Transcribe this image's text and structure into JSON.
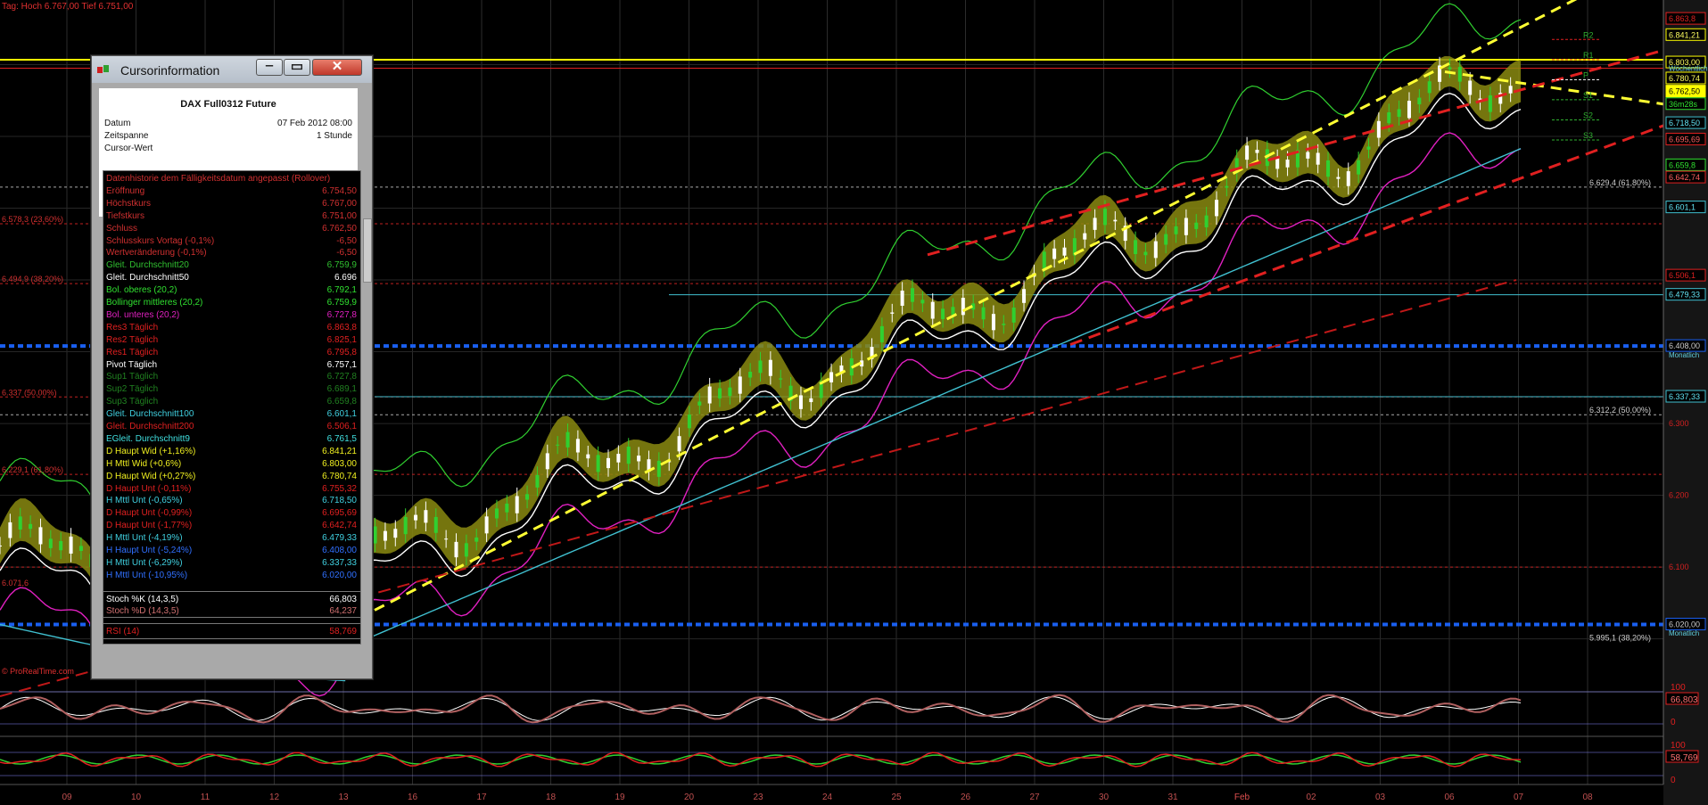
{
  "top_info": "Tag: Hoch 6.767,00  Tief 6.751,00",
  "watermark": "© ProRealTime.com",
  "colors": {
    "background": "#000000",
    "grid": "#2b2b2b",
    "price_axis_bg": "#1a1a1a",
    "red": "#e02020",
    "yellow": "#ffff00",
    "blue": "#1060ff",
    "cyan": "#40c0d0",
    "green": "#30d030",
    "magenta": "#e020c0",
    "olive": "#9a9a10"
  },
  "x_axis": [
    "09",
    "10",
    "11",
    "12",
    "13",
    "16",
    "17",
    "18",
    "19",
    "20",
    "23",
    "24",
    "25",
    "26",
    "27",
    "30",
    "31",
    "Feb",
    "02",
    "03",
    "06",
    "07",
    "08"
  ],
  "price_axis": [
    {
      "label": "6.863,8",
      "price": 6863.8,
      "style": "red"
    },
    {
      "label": "6.841,21",
      "price": 6841.21,
      "style": "yellowbox"
    },
    {
      "label": "6.803,00",
      "price": 6803.0,
      "style": "yellowbox"
    },
    {
      "label": "Wöchentlich",
      "price": 6795,
      "style": "cyantext"
    },
    {
      "label": "6.780,74",
      "price": 6780.74,
      "style": "yellowbox"
    },
    {
      "label": "6.762,50",
      "price": 6762.5,
      "style": "current"
    },
    {
      "label": "36m28s",
      "price": 6745,
      "style": "greenbox"
    },
    {
      "label": "6.718,50",
      "price": 6718.5,
      "style": "cyanbox"
    },
    {
      "label": "6.695,69",
      "price": 6695.69,
      "style": "redbox"
    },
    {
      "label": "6.659,8",
      "price": 6659.8,
      "style": "greenbox"
    },
    {
      "label": "6.642,74",
      "price": 6642.74,
      "style": "redbox"
    },
    {
      "label": "6.601,1",
      "price": 6601.1,
      "style": "cyanbox"
    },
    {
      "label": "6.506,1",
      "price": 6506.1,
      "style": "red"
    },
    {
      "label": "6.479,33",
      "price": 6479.33,
      "style": "cyanbox"
    },
    {
      "label": "6.408,00",
      "price": 6408.0,
      "style": "bluebox"
    },
    {
      "label": "Monatlich",
      "price": 6396,
      "style": "cyantext"
    },
    {
      "label": "6.337,33",
      "price": 6337.33,
      "style": "cyanbox"
    },
    {
      "label": "6.300",
      "price": 6300,
      "style": "tick"
    },
    {
      "label": "6.200",
      "price": 6200,
      "style": "tick"
    },
    {
      "label": "6.100",
      "price": 6100,
      "style": "tick"
    },
    {
      "label": "6.020,00",
      "price": 6020.0,
      "style": "bluebox"
    },
    {
      "label": "Monatlich",
      "price": 6008,
      "style": "cyantext"
    }
  ],
  "fib_labels": [
    {
      "label": "6.629,4 (61,80%)",
      "price": 6629.4,
      "side": "right"
    },
    {
      "label": "6.312,2 (50,00%)",
      "price": 6312.2,
      "side": "right"
    },
    {
      "label": "5.995,1 (38,20%)",
      "price": 5995.1,
      "side": "right"
    },
    {
      "label": "6.578,3 (23,60%)",
      "price": 6578.3,
      "side": "left"
    },
    {
      "label": "6.494,9 (38,20%)",
      "price": 6494.9,
      "side": "left"
    },
    {
      "label": "6.337 (50,00%)",
      "price": 6337,
      "side": "left"
    },
    {
      "label": "6.229,1 (61,80%)",
      "price": 6229.1,
      "side": "left"
    },
    {
      "label": "6.071,6",
      "price": 6071.6,
      "side": "left"
    }
  ],
  "pivot_labels": [
    "R2",
    "R1",
    "P",
    "S1",
    "S2",
    "S3"
  ],
  "stoch_axis": {
    "top": "100",
    "current": "66,803",
    "bottom": "0"
  },
  "rsi_axis": {
    "top": "100",
    "current": "58,769",
    "bottom": "0"
  },
  "cursor_window": {
    "title": "Cursorinformation",
    "instrument": "DAX Full0312 Future",
    "header_rows": [
      {
        "k": "Datum",
        "v": "07 Feb 2012 08:00"
      },
      {
        "k": "Zeitspanne",
        "v": "1 Stunde"
      },
      {
        "k": "Cursor-Wert",
        "v": ""
      }
    ],
    "rows": [
      {
        "k": "Datenhistorie dem Fälligkeitsdatum angepasst (Rollover)",
        "v": "",
        "c": "#d03030"
      },
      {
        "k": "Eröffnung",
        "v": "6.754,50",
        "c": "#d03030"
      },
      {
        "k": "Höchstkurs",
        "v": "6.767,00",
        "c": "#d03030"
      },
      {
        "k": "Tiefstkurs",
        "v": "6.751,00",
        "c": "#d03030"
      },
      {
        "k": "Schluss",
        "v": "6.762,50",
        "c": "#d03030"
      },
      {
        "k": "Schlusskurs Vortag (-0,1%)",
        "v": "-6,50",
        "c": "#d03030"
      },
      {
        "k": "Wertveränderung (-0,1%)",
        "v": "-6,50",
        "c": "#d03030"
      },
      {
        "k": "Gleit. Durchschnitt20",
        "v": "6.759,9",
        "c": "#30c030"
      },
      {
        "k": "Gleit. Durchschnitt50",
        "v": "6.696",
        "c": "#ffffff"
      },
      {
        "k": "Bol. oberes (20,2)",
        "v": "6.792,1",
        "c": "#30e030"
      },
      {
        "k": "Bollinger mittleres (20,2)",
        "v": "6.759,9",
        "c": "#30e030"
      },
      {
        "k": "Bol. unteres (20,2)",
        "v": "6.727,8",
        "c": "#e020c0"
      },
      {
        "k": "Res3 Täglich",
        "v": "6.863,8",
        "c": "#e02020"
      },
      {
        "k": "Res2 Täglich",
        "v": "6.825,1",
        "c": "#e02020"
      },
      {
        "k": "Res1 Täglich",
        "v": "6.795,8",
        "c": "#e02020"
      },
      {
        "k": "Pivot Täglich",
        "v": "6.757,1",
        "c": "#ffffff"
      },
      {
        "k": "Sup1 Täglich",
        "v": "6.727,8",
        "c": "#208020"
      },
      {
        "k": "Sup2 Täglich",
        "v": "6.689,1",
        "c": "#208020"
      },
      {
        "k": "Sup3 Täglich",
        "v": "6.659,8",
        "c": "#208020"
      },
      {
        "k": "Gleit. Durchschnitt100",
        "v": "6.601,1",
        "c": "#40d0e0"
      },
      {
        "k": "Gleit. Durchschnitt200",
        "v": "6.506,1",
        "c": "#e02020"
      },
      {
        "k": "EGleit. Durchschnitt9",
        "v": "6.761,5",
        "c": "#40e0e0"
      },
      {
        "k": "D Haupt Wid (+1,16%)",
        "v": "6.841,21",
        "c": "#f0f020"
      },
      {
        "k": "H Mttl Wid (+0,6%)",
        "v": "6.803,00",
        "c": "#f0f020"
      },
      {
        "k": "D Haupt Wid (+0,27%)",
        "v": "6.780,74",
        "c": "#f0f020"
      },
      {
        "k": "D Haupt Unt (-0,11%)",
        "v": "6.755,32",
        "c": "#e02020"
      },
      {
        "k": "H Mttl Unt (-0,65%)",
        "v": "6.718,50",
        "c": "#40d0e0"
      },
      {
        "k": "D Haupt Unt (-0,99%)",
        "v": "6.695,69",
        "c": "#e02020"
      },
      {
        "k": "D Haupt Unt (-1,77%)",
        "v": "6.642,74",
        "c": "#e02020"
      },
      {
        "k": "H Mttl Unt (-4,19%)",
        "v": "6.479,33",
        "c": "#40d0e0"
      },
      {
        "k": "H Haupt Unt (-5,24%)",
        "v": "6.408,00",
        "c": "#3070ff"
      },
      {
        "k": "H Mttl Unt (-6,29%)",
        "v": "6.337,33",
        "c": "#40d0e0"
      },
      {
        "k": "H Mttl Unt (-10,95%)",
        "v": "6.020,00",
        "c": "#3070ff"
      }
    ],
    "stoch_rows": [
      {
        "k": "Stoch %K (14,3,5)",
        "v": "66,803",
        "c": "#ffffff"
      },
      {
        "k": "Stoch %D (14,3,5)",
        "v": "64,237",
        "c": "#d07070"
      }
    ],
    "rsi_rows": [
      {
        "k": "RSI (14)",
        "v": "58,769",
        "c": "#e02020"
      }
    ]
  }
}
